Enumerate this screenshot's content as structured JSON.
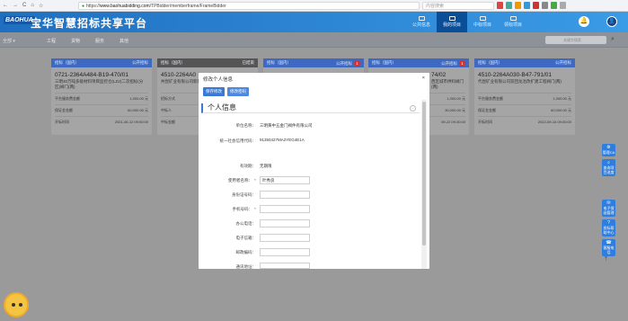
{
  "browser": {
    "url_scheme": "https://",
    "url_host": "www.baohuabidding.com",
    "url_path": "/TPBidder/memberframe/FrameBidder",
    "search_placeholder": "内容搜索",
    "nav": [
      "←",
      "→",
      "C",
      "⌂",
      "☆"
    ]
  },
  "header": {
    "logo": "BAOHUA",
    "title": "宝华智慧招标共享平台",
    "nav": [
      {
        "label": "公共信息",
        "active": false
      },
      {
        "label": "我的项目",
        "active": true
      },
      {
        "label": "中标项目",
        "active": false
      },
      {
        "label": "领标项目",
        "active": false
      }
    ],
    "bell": "🔔",
    "avatar": "👤"
  },
  "filter": {
    "all": "全部 ▾",
    "tabs": [
      "工程",
      "货物",
      "服务",
      "其他"
    ],
    "search_placeholder": "关键字搜索",
    "search_icon": "⌕"
  },
  "cards": [
    {
      "status": "招标（国内）",
      "type": "公开招标",
      "no": "0721-2364A484-B19-470/01",
      "desc": "三明30万吨多级材料项目监控仓(LZ2)二次招标(分区)阀门(两)",
      "r1l": "平台服务费金额",
      "r1v": "1,000.00 元",
      "r2l": "保证金金额",
      "r2v": "60,000.00 元",
      "r3l": "开标时间",
      "r3v": "2021-06-12 09:00:00",
      "gray": false,
      "badge": ""
    },
    {
      "status": "招标（国内）",
      "type": "已结束",
      "no": "4510-2264A0",
      "desc": "共昆矿业有限公司新建选矿厂三期系统升级改造工程",
      "r1l": "招标方式",
      "r1v": "",
      "r2l": "中标人",
      "r2v": "",
      "r3l": "中标金额",
      "r3v": "",
      "gray": true,
      "badge": ""
    },
    {
      "status": "招标（国内）",
      "type": "公开招标",
      "no": "",
      "desc": "",
      "r1l": "",
      "r1v": "",
      "r2l": "",
      "r2v": "",
      "r3l": "",
      "r3v": "",
      "gray": false,
      "badge": "1"
    },
    {
      "status": "招标（国内）",
      "type": "公开招标",
      "no": "74/02",
      "desc": "西区城市供料阀门(两)",
      "r1l": "",
      "r1v": "1,000.00 元",
      "r2l": "",
      "r2v": "30,000.00 元",
      "r3l": "",
      "r3v": "09-22 09:30:00",
      "gray": false,
      "badge": "1"
    },
    {
      "status": "招标（国内）",
      "type": "公开招标",
      "no": "4510-2264A030-B47-791/01",
      "desc": "代昆矿业有限公司双回龙冶改扩建工程阀门(两)",
      "r1l": "平台服务费金额",
      "r1v": "1,000.00 元",
      "r2l": "保证金金额",
      "r2v": "60,000.00 元",
      "r3l": "开标时间",
      "r3v": "2022-09-16 09:00:00",
      "gray": false,
      "badge": ""
    }
  ],
  "modal": {
    "title": "修改个人信息",
    "close": "×",
    "tab_save": "保存修改",
    "tab_back": "修改密码",
    "section": "个人信息",
    "fields": [
      {
        "label": "单位名称：",
        "value": "三明黄中五金门阀件有限公司",
        "type": "text",
        "req": false
      },
      {
        "label": "统一社会信用代码：",
        "value": "91350427MA2YEG4E1A",
        "type": "text",
        "req": false
      },
      {
        "label": "有效期：",
        "value": "无期限",
        "type": "text",
        "req": false
      },
      {
        "label": "使用者名称：",
        "value": "叶秀良",
        "type": "input",
        "req": true
      },
      {
        "label": "身份证号码：",
        "value": "",
        "type": "input",
        "req": false
      },
      {
        "label": "手机号码：",
        "value": "",
        "type": "input",
        "req": true
      },
      {
        "label": "办公电话：",
        "value": "",
        "type": "input",
        "req": false
      },
      {
        "label": "电子信箱：",
        "value": "",
        "type": "input",
        "req": false
      },
      {
        "label": "邮政编码：",
        "value": "",
        "type": "input",
        "req": false
      },
      {
        "label": "通讯地址：",
        "value": "",
        "type": "input",
        "req": false
      }
    ]
  },
  "sidebar_right": [
    {
      "icon": "⚙",
      "label": "管理CA"
    },
    {
      "icon": "⌕",
      "label": "查询项目进度"
    },
    {
      "icon": "✉",
      "label": "电子保函管理"
    },
    {
      "icon": "?",
      "label": "投标帮助中心"
    },
    {
      "icon": "☎",
      "label": "客服电话"
    }
  ],
  "scroll_top": "⤒"
}
